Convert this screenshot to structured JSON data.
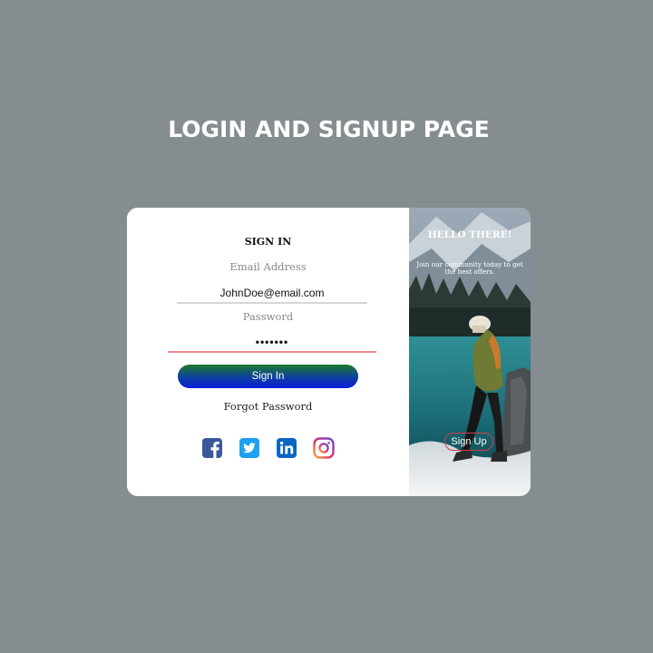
{
  "page": {
    "title": "LOGIN AND SIGNUP PAGE"
  },
  "signin": {
    "heading": "SIGN IN",
    "email_label": "Email Address",
    "email_value": "JohnDoe@email.com",
    "password_label": "Password",
    "password_value": "•••••••",
    "button_label": "Sign In",
    "forgot_label": "Forgot Password"
  },
  "social": {
    "icons": [
      "facebook-icon",
      "twitter-icon",
      "linkedin-icon",
      "instagram-icon"
    ]
  },
  "signup_panel": {
    "title": "HELLO THERE!",
    "text": "Join our community today to get the best offers.",
    "button_label": "Sign Up"
  },
  "colors": {
    "background": "#868d91",
    "card": "#ffffff",
    "signin_gradient_top": "#1d7a2c",
    "signin_gradient_bottom": "#0a1fd8",
    "password_underline": "#ee8a8a",
    "signup_border": "#d23b4d"
  }
}
